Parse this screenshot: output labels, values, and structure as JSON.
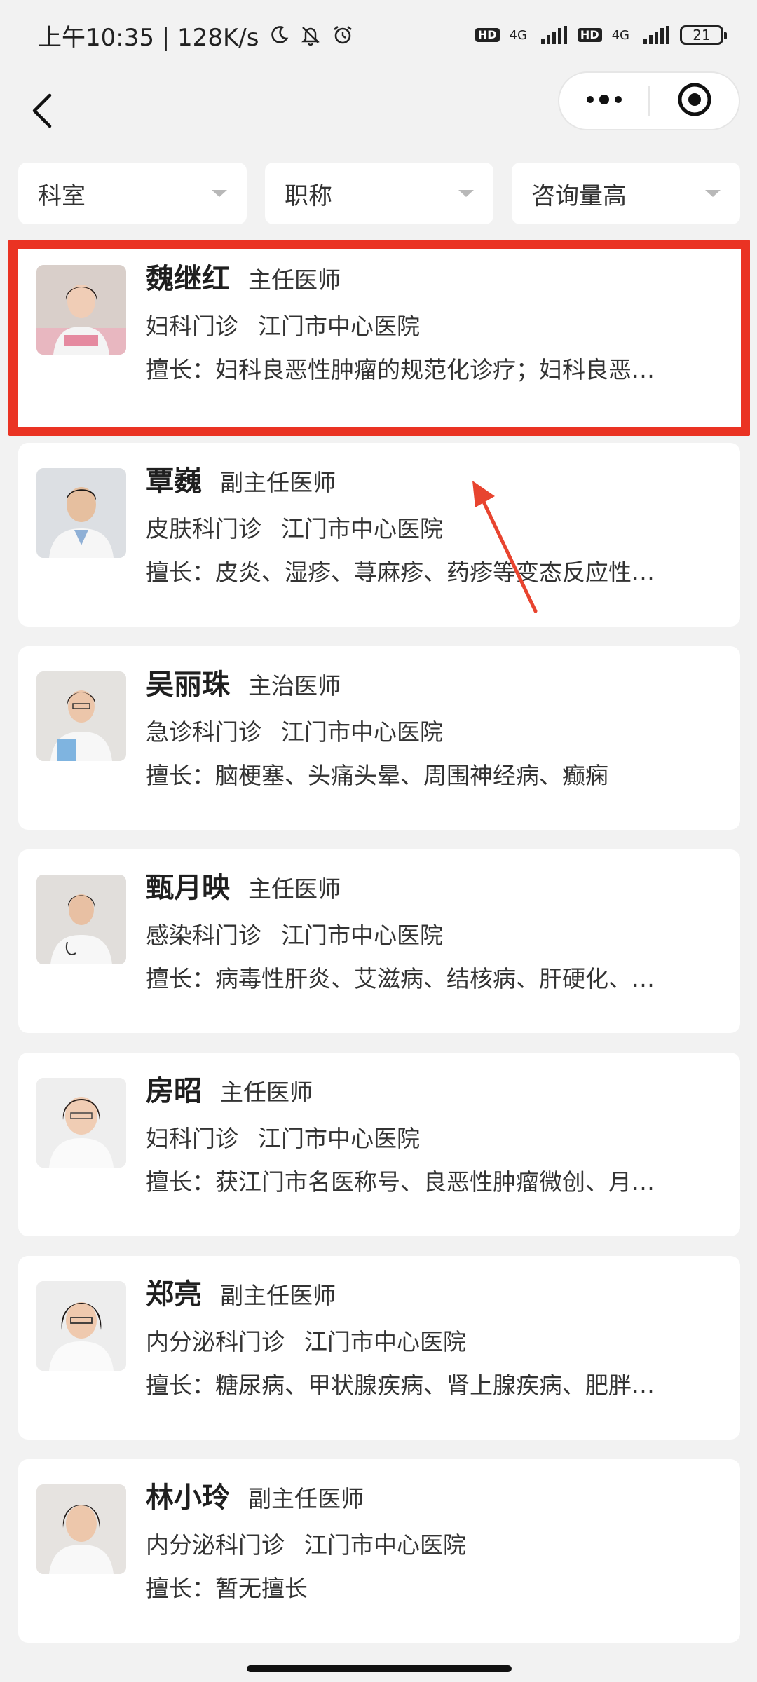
{
  "status_bar": {
    "time_speed": "上午10:35 | 128K/s",
    "icons": [
      "moon-icon",
      "mute-icon",
      "alarm-icon"
    ],
    "sim1": {
      "hd": "HD",
      "network": "4G"
    },
    "sim2": {
      "hd": "HD",
      "network": "4G"
    },
    "battery_level": "21"
  },
  "nav": {
    "back_icon": "chevron-left-icon",
    "more_icon": "more-dots-icon",
    "close_icon": "target-close-icon"
  },
  "filters": [
    {
      "label": "科室"
    },
    {
      "label": "职称"
    },
    {
      "label": "咨询量高"
    }
  ],
  "doctors": [
    {
      "name": "魏继红",
      "title": "主任医师",
      "department": "妇科门诊",
      "hospital": "江门市中心医院",
      "specialty": "擅长：妇科良恶性肿瘤的规范化诊疗；妇科良恶…",
      "highlighted": true
    },
    {
      "name": "覃巍",
      "title": "副主任医师",
      "department": "皮肤科门诊",
      "hospital": "江门市中心医院",
      "specialty": "擅长：皮炎、湿疹、荨麻疹、药疹等变态反应性…"
    },
    {
      "name": "吴丽珠",
      "title": "主治医师",
      "department": "急诊科门诊",
      "hospital": "江门市中心医院",
      "specialty": "擅长：脑梗塞、头痛头晕、周围神经病、癫痫"
    },
    {
      "name": "甄月映",
      "title": "主任医师",
      "department": "感染科门诊",
      "hospital": "江门市中心医院",
      "specialty": "擅长：病毒性肝炎、艾滋病、结核病、肝硬化、…"
    },
    {
      "name": "房昭",
      "title": "主任医师",
      "department": "妇科门诊",
      "hospital": "江门市中心医院",
      "specialty": "擅长：获江门市名医称号、良恶性肿瘤微创、月…"
    },
    {
      "name": "郑亮",
      "title": "副主任医师",
      "department": "内分泌科门诊",
      "hospital": "江门市中心医院",
      "specialty": "擅长：糖尿病、甲状腺疾病、肾上腺疾病、肥胖…"
    },
    {
      "name": "林小玲",
      "title": "副主任医师",
      "department": "内分泌科门诊",
      "hospital": "江门市中心医院",
      "specialty": "擅长：暂无擅长"
    }
  ],
  "colors": {
    "highlight_border": "#ea3323",
    "annotation_arrow": "#e8442f"
  }
}
